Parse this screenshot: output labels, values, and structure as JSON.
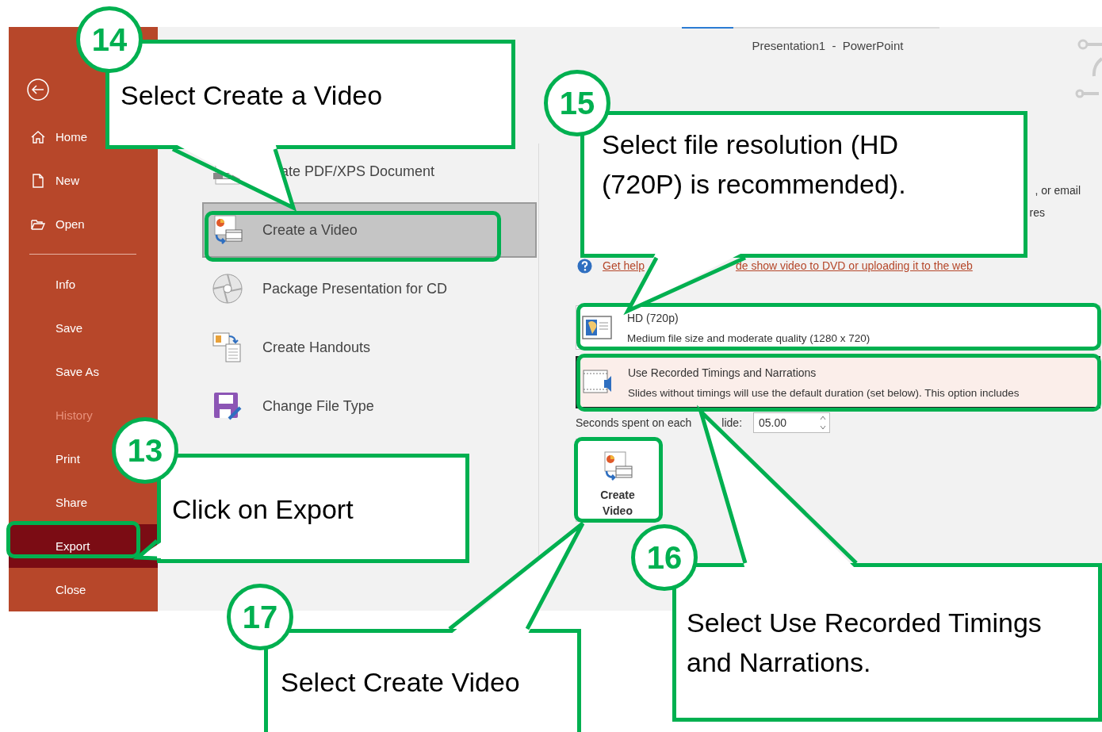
{
  "window": {
    "title": "Presentation1  -  PowerPoint"
  },
  "sidebar": {
    "primary_items": [
      {
        "label": "Home",
        "selected": false,
        "disabled": false
      },
      {
        "label": "New",
        "selected": false,
        "disabled": false
      },
      {
        "label": "Open",
        "selected": false,
        "disabled": false
      }
    ],
    "items": [
      {
        "label": "Info",
        "selected": false,
        "disabled": false
      },
      {
        "label": "Save",
        "selected": false,
        "disabled": false
      },
      {
        "label": "Save As",
        "selected": false,
        "disabled": false
      },
      {
        "label": "History",
        "selected": false,
        "disabled": true
      },
      {
        "label": "Print",
        "selected": false,
        "disabled": false
      },
      {
        "label": "Share",
        "selected": false,
        "disabled": false
      },
      {
        "label": "Export",
        "selected": true,
        "disabled": false
      },
      {
        "label": "Close",
        "selected": false,
        "disabled": false
      }
    ]
  },
  "export_options": [
    {
      "label": "ate PDF/XPS Document",
      "selected": false
    },
    {
      "label": "Create a Video",
      "selected": true
    },
    {
      "label": "Package Presentation for CD",
      "selected": false
    },
    {
      "label": "Create Handouts",
      "selected": false
    },
    {
      "label": "Change File Type",
      "selected": false
    }
  ],
  "video_panel": {
    "description": {
      "line_1_end": ", or email",
      "line_2_end": "res"
    },
    "help_link": {
      "start": "Get help",
      "end": "de show video to DVD or uploading it to the web"
    },
    "quality_option": {
      "title": "HD (720p)",
      "description": "Medium file size and moderate quality (1280 x 720)"
    },
    "timings_option": {
      "title": "Use Recorded Timings and Narrations",
      "description": "Slides without timings will use the default duration (set below). This option includes"
    },
    "seconds": {
      "label_start": "Seconds spent on each",
      "label_end": "lide:",
      "value": "05.00"
    },
    "create_button": {
      "lines": [
        "Create",
        "Video"
      ]
    }
  },
  "annotations": [
    {
      "number": "14",
      "lines": [
        "Select Create a Video"
      ]
    },
    {
      "number": "15",
      "lines": [
        "Select file resolution (HD",
        "(720P) is recommended)."
      ]
    },
    {
      "number": "13",
      "lines": [
        "Click on Export"
      ]
    },
    {
      "number": "16",
      "lines": [
        "Select Use Recorded Timings",
        "and Narrations."
      ]
    },
    {
      "number": "17",
      "lines": [
        "Select Create Video"
      ]
    }
  ]
}
